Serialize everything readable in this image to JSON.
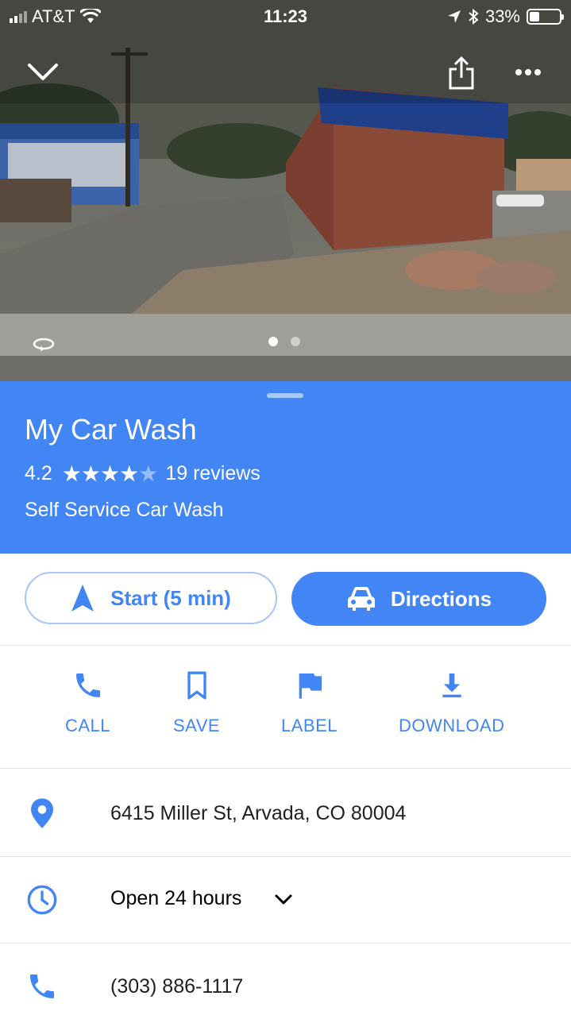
{
  "status_bar": {
    "carrier": "AT&T",
    "time": "11:23",
    "battery": "33%",
    "battery_level": 0.33
  },
  "photo": {
    "page_count": 2,
    "active_page": 1
  },
  "place": {
    "name": "My Car Wash",
    "rating": "4.2",
    "rating_value": 4.2,
    "reviews": "19 reviews",
    "category": "Self Service Car Wash"
  },
  "buttons": {
    "start": "Start (5 min)",
    "directions": "Directions"
  },
  "quick_actions": {
    "call": "CALL",
    "save": "SAVE",
    "label": "LABEL",
    "download": "DOWNLOAD"
  },
  "details": {
    "address": "6415 Miller St, Arvada, CO 80004",
    "hours": "Open 24 hours",
    "phone": "(303) 886-1117"
  },
  "colors": {
    "accent": "#4285f4",
    "text": "#212121",
    "divider": "#e0e0e0"
  }
}
